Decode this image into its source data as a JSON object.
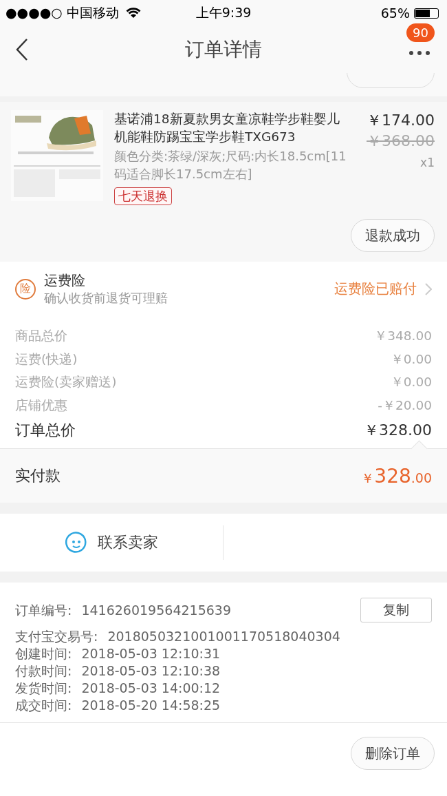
{
  "status_bar": {
    "carrier": "●●●●○ 中国移动",
    "time": "上午9:39",
    "battery_text": "65%"
  },
  "nav": {
    "title": "订单详情",
    "badge": "90"
  },
  "product": {
    "title": "基诺浦18新夏款男女童凉鞋学步鞋婴儿机能鞋防踢宝宝学步鞋TXG673",
    "sku": "颜色分类:茶绿/深灰;尺码:内长18.5cm[11码适合脚长17.5cm左右]",
    "tag": "七天退换",
    "price": "￥174.00",
    "original_price": "￥368.00",
    "quantity": "x1",
    "button": "退款成功"
  },
  "insurance": {
    "icon_text": "险",
    "title": "运费险",
    "subtitle": "确认收货前退货可理赔",
    "status": "运费险已赔付"
  },
  "price_rows": [
    {
      "label": "商品总价",
      "value": "￥348.00"
    },
    {
      "label": "运费(快递)",
      "value": "￥0.00"
    },
    {
      "label": "运费险(卖家赠送)",
      "value": "￥0.00"
    },
    {
      "label": "店铺优惠",
      "value": "-￥20.00"
    }
  ],
  "total": {
    "label": "订单总价",
    "value": "￥328.00"
  },
  "paid": {
    "label": "实付款",
    "currency": "￥",
    "integer": "328",
    "decimals": ".00"
  },
  "contact": {
    "label": "联系卖家"
  },
  "info": {
    "copy_button": "复制",
    "rows": [
      {
        "label": "订单编号:",
        "value": "141626019564215639"
      },
      {
        "label": "支付宝交易号:",
        "value": "2018050321001001170518040304"
      },
      {
        "label": "创建时间:",
        "value": "2018-05-03 12:10:31"
      },
      {
        "label": "付款时间:",
        "value": "2018-05-03 12:10:38"
      },
      {
        "label": "发货时间:",
        "value": "2018-05-03 14:00:12"
      },
      {
        "label": "成交时间:",
        "value": "2018-05-20 14:58:25"
      }
    ]
  },
  "footer": {
    "button": "删除订单"
  }
}
